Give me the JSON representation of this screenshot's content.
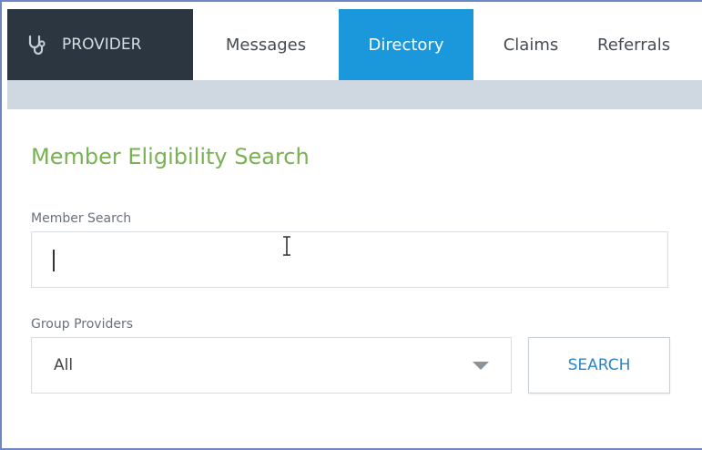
{
  "nav": {
    "brand_label": "PROVIDER",
    "brand_icon": "stethoscope-icon",
    "tabs": [
      {
        "label": "Messages"
      },
      {
        "label": "Directory",
        "active": true
      },
      {
        "label": "Claims"
      },
      {
        "label": "Referrals"
      }
    ]
  },
  "main": {
    "title": "Member Eligibility Search",
    "member_search": {
      "label": "Member Search",
      "value": "",
      "placeholder": ""
    },
    "group_providers": {
      "label": "Group Providers",
      "selected": "All"
    },
    "search_button": "SEARCH"
  },
  "colors": {
    "brand_bg": "#2c3640",
    "active_tab": "#1b97dc",
    "title_green": "#7ab152",
    "button_text": "#2a87c8",
    "subbar": "#cfd8e1"
  }
}
